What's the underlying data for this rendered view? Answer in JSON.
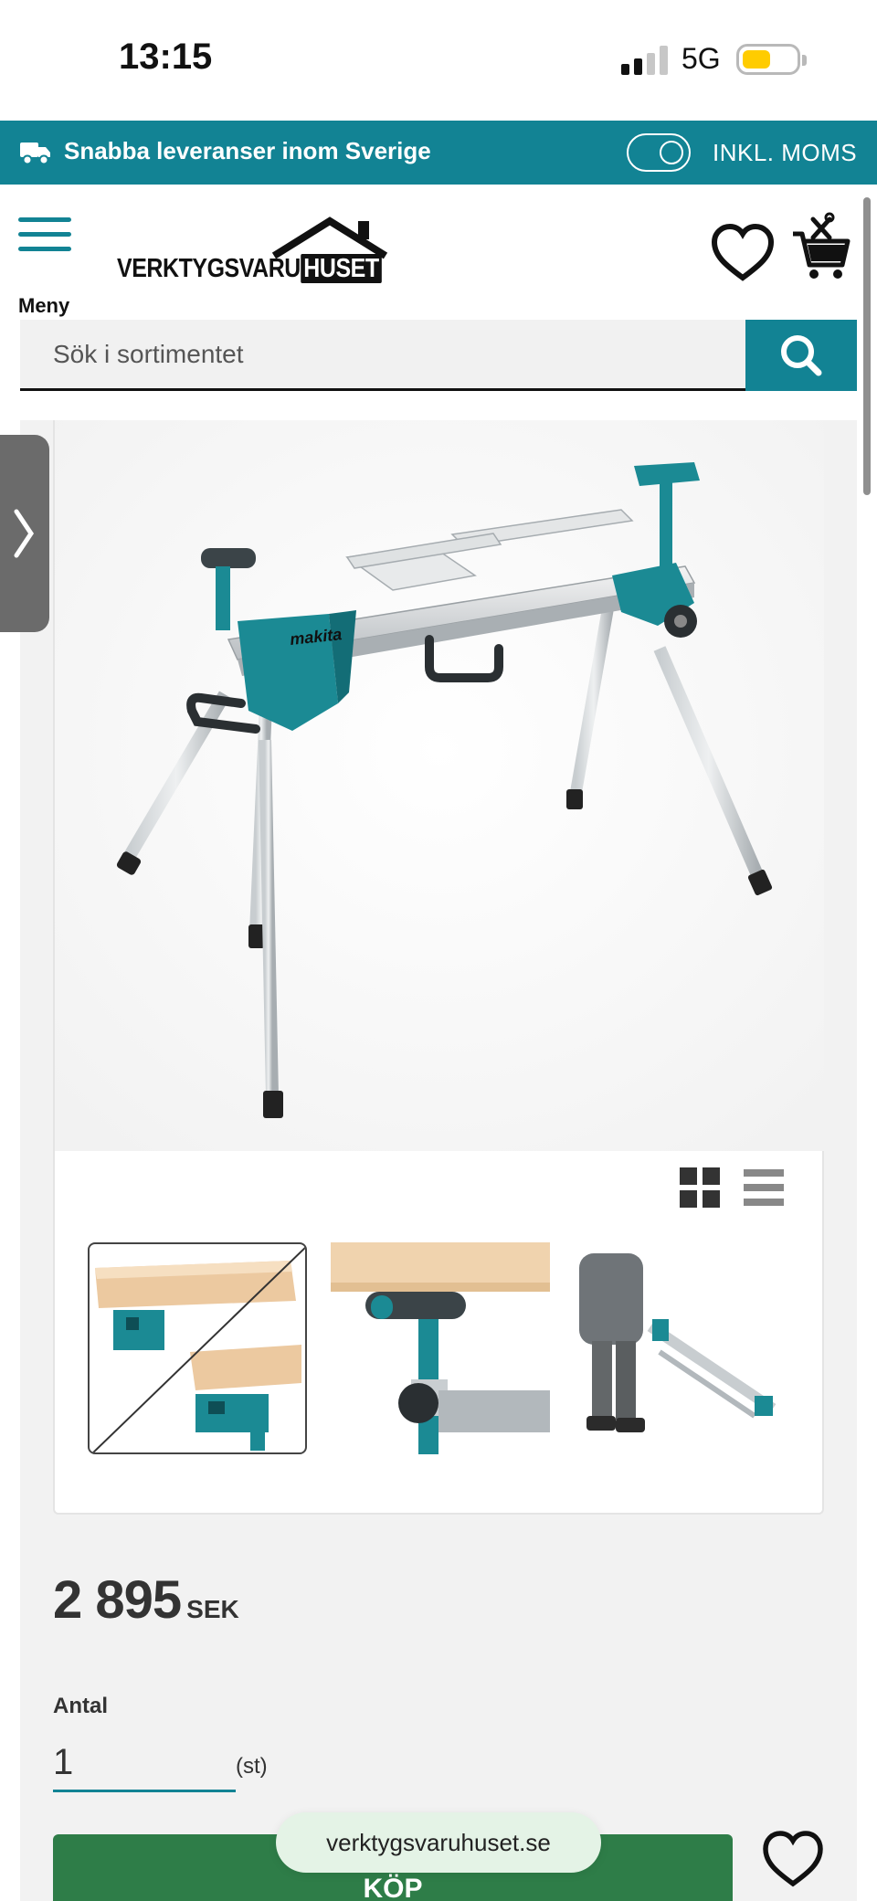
{
  "status_bar": {
    "time": "13:15",
    "network": "5G"
  },
  "promo_bar": {
    "text": "Snabba leveranser inom Sverige",
    "vat_label": "INKL. MOMS"
  },
  "header": {
    "menu_label": "Meny",
    "logo": {
      "text_main": "VERKTYGSVARU",
      "text_highlight": "HUSET"
    },
    "search_placeholder": "Sök i sortimentet"
  },
  "gallery": {
    "main_image": "makita-miter-saw-stand",
    "thumbnails": [
      "stand-top-detail",
      "roller-support-detail",
      "person-carrying-stand"
    ]
  },
  "product": {
    "price_value": "2 895",
    "price_currency": "SEK",
    "quantity_label": "Antal",
    "quantity_value": "1",
    "quantity_unit": "(st)",
    "buy_label": "KÖP"
  },
  "browser": {
    "url": "verktygsvaruhuset.se"
  },
  "colors": {
    "brand": "#128394",
    "buy": "#2e7d48",
    "battery": "#ffcc00"
  }
}
